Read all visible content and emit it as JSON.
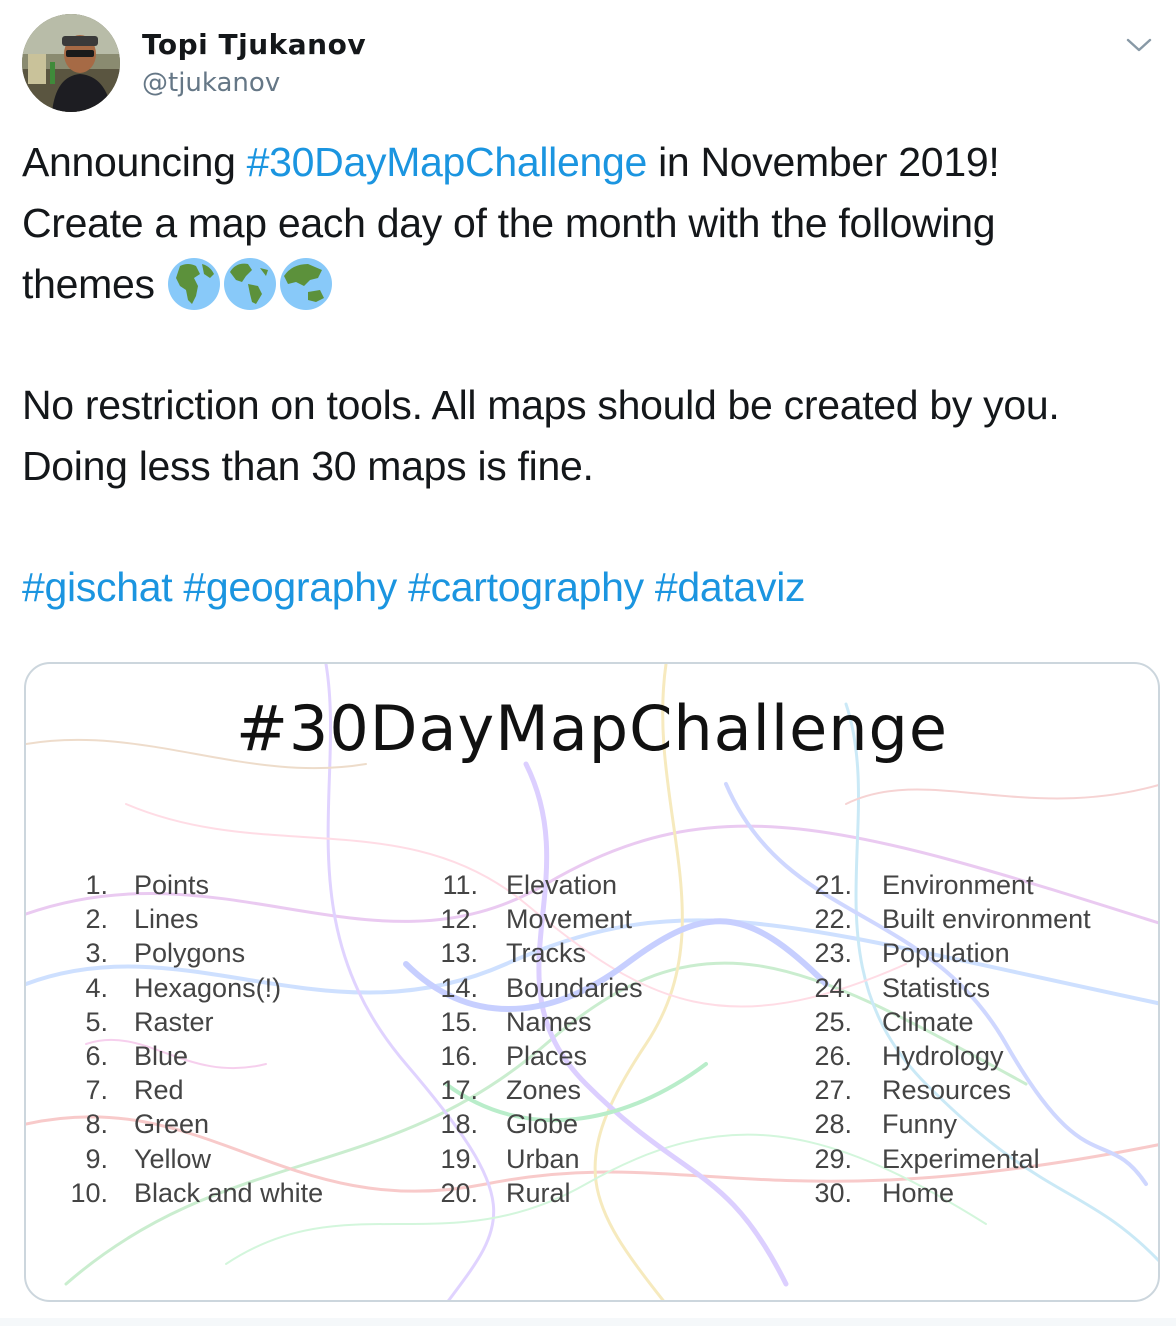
{
  "author": {
    "name": "Topi Tjukanov",
    "handle": "@tjukanov"
  },
  "tweet": {
    "line1_prefix": "Announcing ",
    "line1_hashtag": "#30DayMapChallenge",
    "line1_suffix": " in November 2019!",
    "line2": "Create a map each day of the month with the following",
    "line3": "themes ",
    "globe_icons": [
      "globe-africa-europe-icon",
      "globe-americas-icon",
      "globe-asia-australia-icon"
    ],
    "para2_line1": "No restriction on tools. All maps should be created by you.",
    "para2_line2": "Doing less than 30 maps is fine.",
    "hashtags": [
      "#gischat",
      "#geography",
      "#cartography",
      "#dataviz"
    ]
  },
  "card": {
    "title": "#30DayMapChallenge",
    "columns": [
      [
        {
          "num": "1.",
          "label": "Points"
        },
        {
          "num": "2.",
          "label": "Lines"
        },
        {
          "num": "3.",
          "label": "Polygons"
        },
        {
          "num": "4.",
          "label": "Hexagons(!)"
        },
        {
          "num": "5.",
          "label": "Raster"
        },
        {
          "num": "6.",
          "label": "Blue"
        },
        {
          "num": "7.",
          "label": "Red"
        },
        {
          "num": "8.",
          "label": "Green"
        },
        {
          "num": "9.",
          "label": "Yellow"
        },
        {
          "num": "10.",
          "label": "Black and white"
        }
      ],
      [
        {
          "num": "11.",
          "label": "Elevation"
        },
        {
          "num": "12.",
          "label": "Movement"
        },
        {
          "num": "13.",
          "label": "Tracks"
        },
        {
          "num": "14.",
          "label": "Boundaries"
        },
        {
          "num": "15.",
          "label": "Names"
        },
        {
          "num": "16.",
          "label": "Places"
        },
        {
          "num": "17.",
          "label": "Zones"
        },
        {
          "num": "18.",
          "label": "Globe"
        },
        {
          "num": "19.",
          "label": "Urban"
        },
        {
          "num": "20.",
          "label": "Rural"
        }
      ],
      [
        {
          "num": "21.",
          "label": "Environment"
        },
        {
          "num": "22.",
          "label": "Built environment"
        },
        {
          "num": "23.",
          "label": "Population"
        },
        {
          "num": "24.",
          "label": "Statistics"
        },
        {
          "num": "25.",
          "label": "Climate"
        },
        {
          "num": "26.",
          "label": "Hydrology"
        },
        {
          "num": "27.",
          "label": "Resources"
        },
        {
          "num": "28.",
          "label": "Funny"
        },
        {
          "num": "29.",
          "label": "Experimental"
        },
        {
          "num": "30.",
          "label": "Home"
        }
      ]
    ]
  },
  "colors": {
    "link": "#1b95e0",
    "text": "#14171a",
    "secondary": "#657786",
    "border": "#ccd6dd"
  }
}
